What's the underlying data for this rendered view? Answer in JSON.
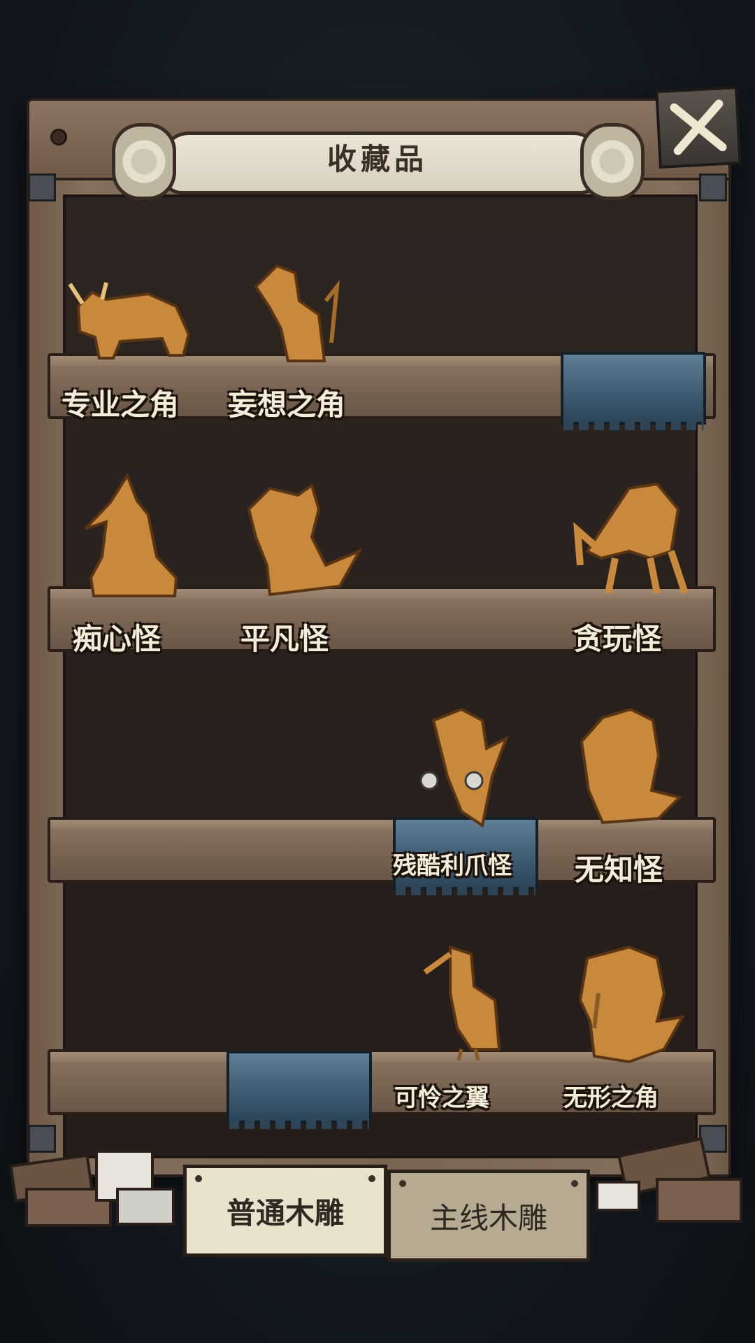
{
  "title": "收藏品",
  "close_icon": "close-x-icon",
  "shelves": [
    {
      "items": [
        "专业之角",
        "妄想之角"
      ]
    },
    {
      "items": [
        "痴心怪",
        "平凡怪",
        "贪玩怪"
      ]
    },
    {
      "items": [
        "残酷利爪怪",
        "无知怪"
      ]
    },
    {
      "items": [
        "可怜之翼",
        "无形之角"
      ]
    }
  ],
  "tabs": [
    {
      "label": "普通木雕",
      "active": true
    },
    {
      "label": "主线木雕",
      "active": false
    }
  ],
  "colors": {
    "carving": "#c9893d",
    "cloth": "#3f5d74",
    "wood": "#7a6553",
    "parchment": "#e8e1cc"
  }
}
